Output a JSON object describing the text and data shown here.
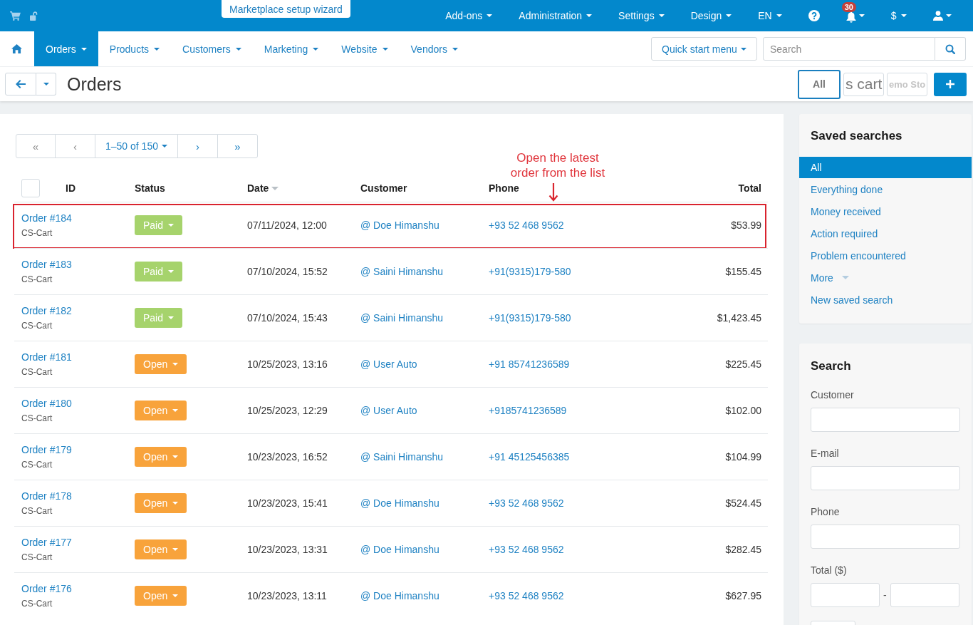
{
  "top_bar": {
    "wizard_button": "Marketplace setup wizard",
    "menu": [
      {
        "kind": "menu",
        "label": "Add-ons"
      },
      {
        "kind": "menu",
        "label": "Administration"
      },
      {
        "kind": "menu",
        "label": "Settings"
      },
      {
        "kind": "menu",
        "label": "Design"
      },
      {
        "kind": "menu",
        "label": "EN"
      },
      {
        "kind": "help"
      },
      {
        "kind": "notifications",
        "badge": "30"
      },
      {
        "kind": "menu",
        "label": "$"
      },
      {
        "kind": "user"
      }
    ]
  },
  "nav": {
    "items": [
      {
        "kind": "home",
        "selected": false
      },
      {
        "kind": "menu",
        "label": "Orders",
        "selected": true
      },
      {
        "kind": "menu",
        "label": "Products",
        "selected": false
      },
      {
        "kind": "menu",
        "label": "Customers",
        "selected": false
      },
      {
        "kind": "menu",
        "label": "Marketing",
        "selected": false
      },
      {
        "kind": "menu",
        "label": "Website",
        "selected": false
      },
      {
        "kind": "menu",
        "label": "Vendors",
        "selected": false
      }
    ],
    "quick_start": "Quick start menu",
    "search": {
      "placeholder": "Search"
    }
  },
  "page_header": {
    "title": "Orders",
    "storefronts": [
      {
        "kind": "text",
        "label": "All",
        "selected": true
      },
      {
        "kind": "logo",
        "label": "s cart",
        "selected": false
      },
      {
        "kind": "logo-bold",
        "label": "emo Sto",
        "selected": false
      }
    ]
  },
  "pagination": [
    {
      "kind": "nav",
      "label": "«",
      "disabled": true
    },
    {
      "kind": "nav",
      "label": "‹",
      "disabled": true
    },
    {
      "kind": "range",
      "label": "1–50 of 150",
      "disabled": false
    },
    {
      "kind": "nav",
      "label": "›",
      "disabled": false
    },
    {
      "kind": "nav",
      "label": "»",
      "disabled": false
    }
  ],
  "table": {
    "select_all": {
      "checked": false
    },
    "columns": [
      {
        "label": "ID",
        "sorted": false
      },
      {
        "label": "Status",
        "sorted": false
      },
      {
        "label": "Date",
        "sorted": true
      },
      {
        "label": "Customer",
        "sorted": false
      },
      {
        "label": "Phone",
        "sorted": false
      },
      {
        "label": "Total",
        "sorted": false
      }
    ],
    "rows": [
      {
        "id": "Order #184",
        "storefront": "CS-Cart",
        "status": {
          "label": "Paid",
          "color": "#a6d36c"
        },
        "date": "07/11/2024, 12:00",
        "customer": "@ Doe Himanshu",
        "phone": "+93 52 468 9562",
        "total": "$53.99",
        "highlighted": true
      },
      {
        "id": "Order #183",
        "storefront": "CS-Cart",
        "status": {
          "label": "Paid",
          "color": "#a6d36c"
        },
        "date": "07/10/2024, 15:52",
        "customer": "@ Saini Himanshu",
        "phone": "+91(9315)179-580",
        "total": "$155.45",
        "highlighted": false
      },
      {
        "id": "Order #182",
        "storefront": "CS-Cart",
        "status": {
          "label": "Paid",
          "color": "#a6d36c"
        },
        "date": "07/10/2024, 15:43",
        "customer": "@ Saini Himanshu",
        "phone": "+91(9315)179-580",
        "total": "$1,423.45",
        "highlighted": false
      },
      {
        "id": "Order #181",
        "storefront": "CS-Cart",
        "status": {
          "label": "Open",
          "color": "#f8a33b"
        },
        "date": "10/25/2023, 13:16",
        "customer": "@ User Auto",
        "phone": "+91 85741236589",
        "total": "$225.45",
        "highlighted": false
      },
      {
        "id": "Order #180",
        "storefront": "CS-Cart",
        "status": {
          "label": "Open",
          "color": "#f8a33b"
        },
        "date": "10/25/2023, 12:29",
        "customer": "@ User Auto",
        "phone": "+9185741236589",
        "total": "$102.00",
        "highlighted": false
      },
      {
        "id": "Order #179",
        "storefront": "CS-Cart",
        "status": {
          "label": "Open",
          "color": "#f8a33b"
        },
        "date": "10/23/2023, 16:52",
        "customer": "@ Saini Himanshu",
        "phone": "+91 45125456385",
        "total": "$104.99",
        "highlighted": false
      },
      {
        "id": "Order #178",
        "storefront": "CS-Cart",
        "status": {
          "label": "Open",
          "color": "#f8a33b"
        },
        "date": "10/23/2023, 15:41",
        "customer": "@ Doe Himanshu",
        "phone": "+93 52 468 9562",
        "total": "$524.45",
        "highlighted": false
      },
      {
        "id": "Order #177",
        "storefront": "CS-Cart",
        "status": {
          "label": "Open",
          "color": "#f8a33b"
        },
        "date": "10/23/2023, 13:31",
        "customer": "@ Doe Himanshu",
        "phone": "+93 52 468 9562",
        "total": "$282.45",
        "highlighted": false
      },
      {
        "id": "Order #176",
        "storefront": "CS-Cart",
        "status": {
          "label": "Open",
          "color": "#f8a33b"
        },
        "date": "10/23/2023, 13:11",
        "customer": "@ Doe Himanshu",
        "phone": "+93 52 468 9562",
        "total": "$627.95",
        "highlighted": false
      }
    ]
  },
  "annotation": {
    "text": "Open the latest order from the list"
  },
  "saved_searches": {
    "title": "Saved searches",
    "items": [
      {
        "kind": "link",
        "label": "All",
        "selected": true
      },
      {
        "kind": "link",
        "label": "Everything done",
        "selected": false
      },
      {
        "kind": "link",
        "label": "Money received",
        "selected": false
      },
      {
        "kind": "link",
        "label": "Action required",
        "selected": false
      },
      {
        "kind": "link",
        "label": "Problem encountered",
        "selected": false
      },
      {
        "kind": "dropdown",
        "label": "More",
        "selected": false
      },
      {
        "kind": "link",
        "label": "New saved search",
        "selected": false
      }
    ]
  },
  "search_panel": {
    "title": "Search",
    "fields": [
      {
        "kind": "text",
        "label": "Customer"
      },
      {
        "kind": "text",
        "label": "E-mail"
      },
      {
        "kind": "text",
        "label": "Phone"
      },
      {
        "kind": "range",
        "label": "Total ($)",
        "separator": "-"
      },
      {
        "kind": "small"
      }
    ]
  }
}
